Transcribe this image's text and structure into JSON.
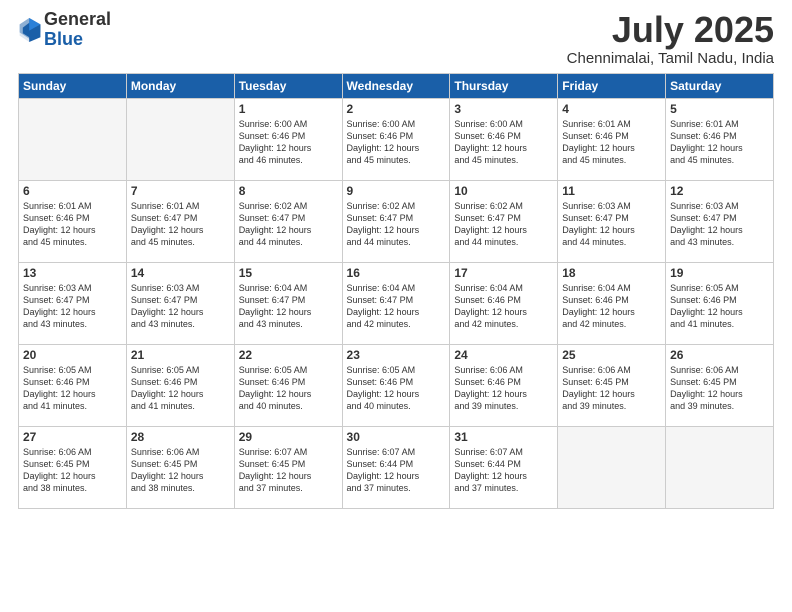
{
  "header": {
    "logo_general": "General",
    "logo_blue": "Blue",
    "month": "July 2025",
    "location": "Chennimalai, Tamil Nadu, India"
  },
  "weekdays": [
    "Sunday",
    "Monday",
    "Tuesday",
    "Wednesday",
    "Thursday",
    "Friday",
    "Saturday"
  ],
  "weeks": [
    [
      {
        "day": "",
        "info": ""
      },
      {
        "day": "",
        "info": ""
      },
      {
        "day": "1",
        "info": "Sunrise: 6:00 AM\nSunset: 6:46 PM\nDaylight: 12 hours\nand 46 minutes."
      },
      {
        "day": "2",
        "info": "Sunrise: 6:00 AM\nSunset: 6:46 PM\nDaylight: 12 hours\nand 45 minutes."
      },
      {
        "day": "3",
        "info": "Sunrise: 6:00 AM\nSunset: 6:46 PM\nDaylight: 12 hours\nand 45 minutes."
      },
      {
        "day": "4",
        "info": "Sunrise: 6:01 AM\nSunset: 6:46 PM\nDaylight: 12 hours\nand 45 minutes."
      },
      {
        "day": "5",
        "info": "Sunrise: 6:01 AM\nSunset: 6:46 PM\nDaylight: 12 hours\nand 45 minutes."
      }
    ],
    [
      {
        "day": "6",
        "info": "Sunrise: 6:01 AM\nSunset: 6:46 PM\nDaylight: 12 hours\nand 45 minutes."
      },
      {
        "day": "7",
        "info": "Sunrise: 6:01 AM\nSunset: 6:47 PM\nDaylight: 12 hours\nand 45 minutes."
      },
      {
        "day": "8",
        "info": "Sunrise: 6:02 AM\nSunset: 6:47 PM\nDaylight: 12 hours\nand 44 minutes."
      },
      {
        "day": "9",
        "info": "Sunrise: 6:02 AM\nSunset: 6:47 PM\nDaylight: 12 hours\nand 44 minutes."
      },
      {
        "day": "10",
        "info": "Sunrise: 6:02 AM\nSunset: 6:47 PM\nDaylight: 12 hours\nand 44 minutes."
      },
      {
        "day": "11",
        "info": "Sunrise: 6:03 AM\nSunset: 6:47 PM\nDaylight: 12 hours\nand 44 minutes."
      },
      {
        "day": "12",
        "info": "Sunrise: 6:03 AM\nSunset: 6:47 PM\nDaylight: 12 hours\nand 43 minutes."
      }
    ],
    [
      {
        "day": "13",
        "info": "Sunrise: 6:03 AM\nSunset: 6:47 PM\nDaylight: 12 hours\nand 43 minutes."
      },
      {
        "day": "14",
        "info": "Sunrise: 6:03 AM\nSunset: 6:47 PM\nDaylight: 12 hours\nand 43 minutes."
      },
      {
        "day": "15",
        "info": "Sunrise: 6:04 AM\nSunset: 6:47 PM\nDaylight: 12 hours\nand 43 minutes."
      },
      {
        "day": "16",
        "info": "Sunrise: 6:04 AM\nSunset: 6:47 PM\nDaylight: 12 hours\nand 42 minutes."
      },
      {
        "day": "17",
        "info": "Sunrise: 6:04 AM\nSunset: 6:46 PM\nDaylight: 12 hours\nand 42 minutes."
      },
      {
        "day": "18",
        "info": "Sunrise: 6:04 AM\nSunset: 6:46 PM\nDaylight: 12 hours\nand 42 minutes."
      },
      {
        "day": "19",
        "info": "Sunrise: 6:05 AM\nSunset: 6:46 PM\nDaylight: 12 hours\nand 41 minutes."
      }
    ],
    [
      {
        "day": "20",
        "info": "Sunrise: 6:05 AM\nSunset: 6:46 PM\nDaylight: 12 hours\nand 41 minutes."
      },
      {
        "day": "21",
        "info": "Sunrise: 6:05 AM\nSunset: 6:46 PM\nDaylight: 12 hours\nand 41 minutes."
      },
      {
        "day": "22",
        "info": "Sunrise: 6:05 AM\nSunset: 6:46 PM\nDaylight: 12 hours\nand 40 minutes."
      },
      {
        "day": "23",
        "info": "Sunrise: 6:05 AM\nSunset: 6:46 PM\nDaylight: 12 hours\nand 40 minutes."
      },
      {
        "day": "24",
        "info": "Sunrise: 6:06 AM\nSunset: 6:46 PM\nDaylight: 12 hours\nand 39 minutes."
      },
      {
        "day": "25",
        "info": "Sunrise: 6:06 AM\nSunset: 6:45 PM\nDaylight: 12 hours\nand 39 minutes."
      },
      {
        "day": "26",
        "info": "Sunrise: 6:06 AM\nSunset: 6:45 PM\nDaylight: 12 hours\nand 39 minutes."
      }
    ],
    [
      {
        "day": "27",
        "info": "Sunrise: 6:06 AM\nSunset: 6:45 PM\nDaylight: 12 hours\nand 38 minutes."
      },
      {
        "day": "28",
        "info": "Sunrise: 6:06 AM\nSunset: 6:45 PM\nDaylight: 12 hours\nand 38 minutes."
      },
      {
        "day": "29",
        "info": "Sunrise: 6:07 AM\nSunset: 6:45 PM\nDaylight: 12 hours\nand 37 minutes."
      },
      {
        "day": "30",
        "info": "Sunrise: 6:07 AM\nSunset: 6:44 PM\nDaylight: 12 hours\nand 37 minutes."
      },
      {
        "day": "31",
        "info": "Sunrise: 6:07 AM\nSunset: 6:44 PM\nDaylight: 12 hours\nand 37 minutes."
      },
      {
        "day": "",
        "info": ""
      },
      {
        "day": "",
        "info": ""
      }
    ]
  ]
}
